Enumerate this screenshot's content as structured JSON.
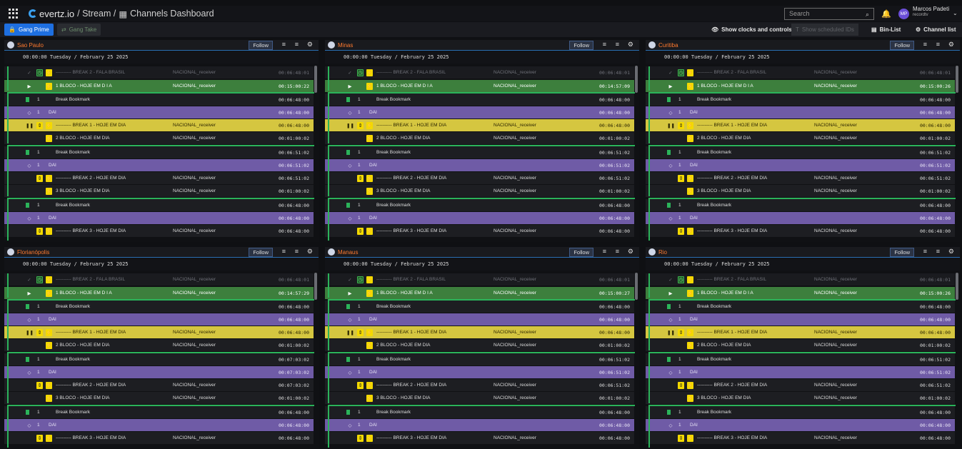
{
  "header": {
    "brand": "evertz.io",
    "breadcrumb": "/ Stream / ",
    "page_icon": "dashboard-icon",
    "page": "Channels Dashboard",
    "search_placeholder": "Search",
    "user_initials": "MP",
    "user_name": "Marcos Padeti",
    "user_role": "recordtv"
  },
  "toolbar": {
    "gang_prime": "Gang Prime",
    "gang_take": "Gang Take",
    "show_clocks": "Show clocks and controls",
    "show_ids": "Show scheduled IDs",
    "bin_list": "Bin-List",
    "channel_list": "Channel list"
  },
  "panels": [
    {
      "name": "Sao Paulo",
      "follow": "Follow",
      "date": "00:00:00  Tuesday / February 25 2025",
      "times": [
        "00:06:48:01",
        "00:15:00:22",
        "00:06:48:00",
        "00:06:48:00",
        "00:06:48:00",
        "00:01:00:02",
        "00:06:51:02",
        "00:06:51:02",
        "00:06:51:02",
        "00:01:00:02",
        "00:06:48:00",
        "00:06:48:00",
        "00:06:48:00"
      ]
    },
    {
      "name": "Minas",
      "follow": "Follow",
      "date": "00:00:00  Tuesday / February 25 2025",
      "times": [
        "00:06:48:01",
        "00:14:57:09",
        "00:06:48:00",
        "00:06:48:00",
        "00:06:48:00",
        "00:01:00:02",
        "00:06:51:02",
        "00:06:51:02",
        "00:06:51:02",
        "00:01:00:02",
        "00:06:48:00",
        "00:06:48:00",
        "00:06:48:00"
      ]
    },
    {
      "name": "Curitiba",
      "follow": "Follow",
      "date": "00:00:00  Tuesday / February 25 2025",
      "times": [
        "00:06:48:01",
        "00:15:00:26",
        "00:06:48:00",
        "00:06:48:00",
        "00:06:48:00",
        "00:01:00:02",
        "00:06:51:02",
        "00:06:51:02",
        "00:06:51:02",
        "00:01:00:02",
        "00:06:48:00",
        "00:06:48:00",
        "00:06:48:00"
      ]
    },
    {
      "name": "Florianópolis",
      "follow": "Follow",
      "date": "00:00:00  Tuesday / February 25 2025",
      "times": [
        "00:06:48:01",
        "00:14:57:29",
        "00:06:48:00",
        "00:06:48:00",
        "00:06:48:00",
        "00:01:00:02",
        "00:07:03:02",
        "00:07:03:02",
        "00:07:03:02",
        "00:01:00:02",
        "00:06:48:00",
        "00:06:48:00",
        "00:06:48:00"
      ]
    },
    {
      "name": "Manaus",
      "follow": "Follow",
      "date": "00:00:00  Tuesday / February 25 2025",
      "times": [
        "00:06:48:01",
        "00:15:00:27",
        "00:06:48:00",
        "00:06:48:00",
        "00:06:48:00",
        "00:01:00:02",
        "00:06:51:02",
        "00:06:51:02",
        "00:06:51:02",
        "00:01:00:02",
        "00:06:48:00",
        "00:06:48:00",
        "00:06:48:00"
      ]
    },
    {
      "name": "Rio",
      "follow": "Follow",
      "date": "00:00:00  Tuesday / February 25 2025",
      "times": [
        "00:06:48:01",
        "00:15:00:26",
        "00:06:48:00",
        "00:06:48:00",
        "00:06:48:00",
        "00:01:00:02",
        "00:06:51:02",
        "00:06:51:02",
        "00:06:51:02",
        "00:01:00:02",
        "00:06:48:00",
        "00:06:48:00",
        "00:06:48:00"
      ]
    }
  ],
  "rows": {
    "break2_fala": "---------- BREAK 2 - FALA BRASIL",
    "bloco1": "1 BLOCO - HOJE EM D I A",
    "bookmark": "Break Bookmark",
    "dai": "DAI",
    "break1": "---------- BREAK 1 - HOJE EM DIA",
    "bloco2": "2 BLOCO - HOJE EM DIA",
    "break2": "---------- BREAK 2 - HOJE EM DIA",
    "bloco3": "3 BLOCO - HOJE EM DIA",
    "break3": "---------- BREAK 3 - HOJE EM DIA",
    "receiver": "NACIONAL_receiver",
    "one": "1"
  }
}
